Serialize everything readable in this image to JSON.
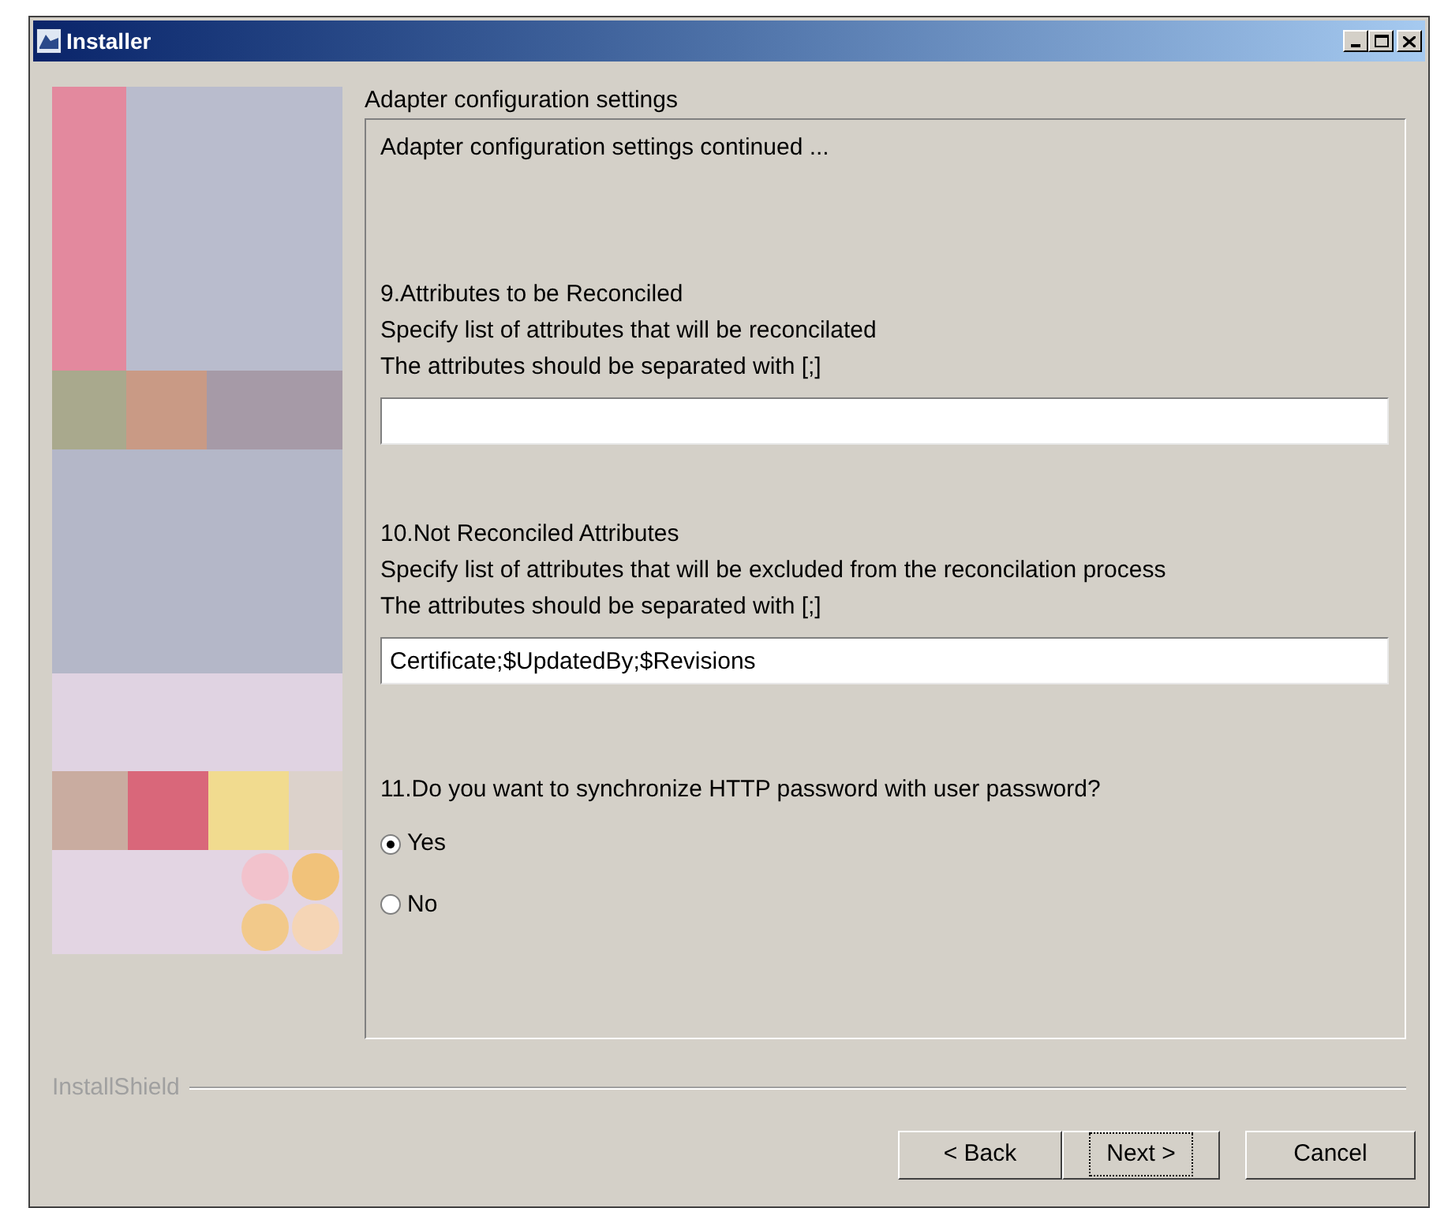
{
  "window": {
    "title": "Installer"
  },
  "group_label": "Adapter configuration settings",
  "intro": "Adapter configuration settings continued ...",
  "sections": [
    {
      "kind": "field",
      "heading": "9.Attributes to be Reconciled",
      "lines": [
        "Specify list of attributes that will be reconcilated",
        "The attributes should be separated with [;]"
      ]
    },
    {
      "kind": "field",
      "heading": "10.Not Reconciled Attributes",
      "lines": [
        "Specify list of attributes that will be excluded from the reconcilation process",
        "The attributes should be separated with [;]"
      ],
      "value": "Certificate;$UpdatedBy;$Revisions"
    },
    {
      "kind": "radio",
      "heading": "11.Do you want to synchronize HTTP password with user password?",
      "options": [
        {
          "label": "Yes",
          "selected": true
        },
        {
          "label": "No",
          "selected": false
        }
      ]
    }
  ],
  "brand": "InstallShield",
  "buttons": [
    {
      "label": "< Back",
      "focused": false
    },
    {
      "label": "Next >",
      "focused": true
    },
    {
      "label": "Cancel",
      "focused": false
    }
  ]
}
